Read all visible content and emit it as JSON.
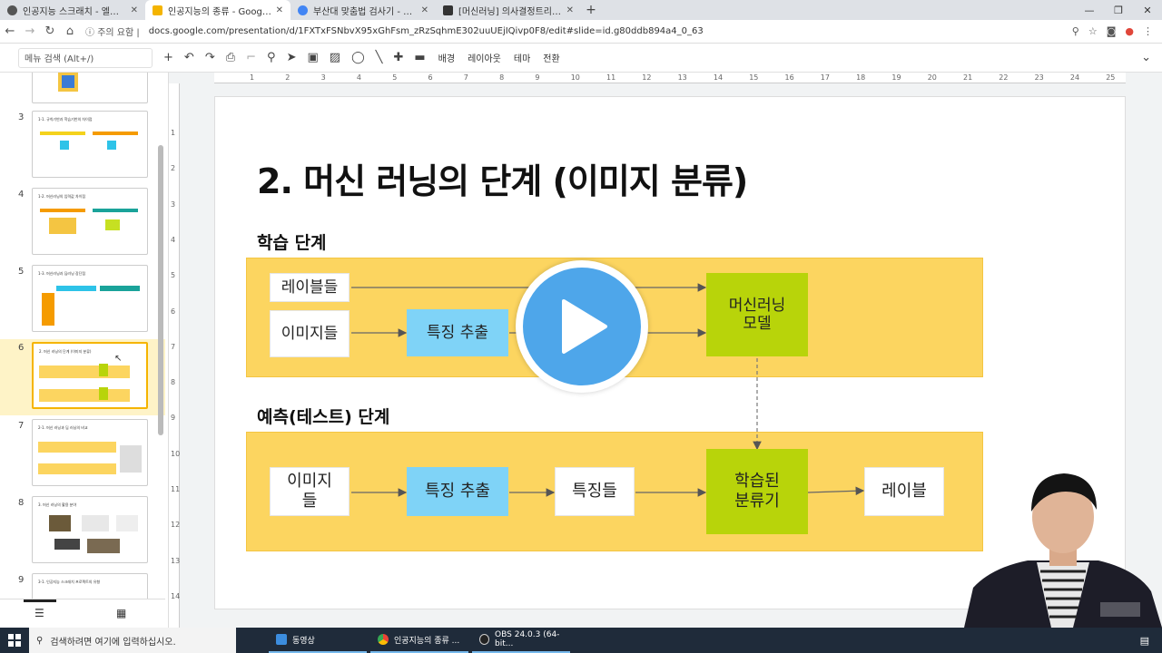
{
  "browser": {
    "tabs": [
      {
        "title": "인공지능 스크래치 - 엘로소프트",
        "favicon_color": "#555555"
      },
      {
        "title": "인공지능의 종류 - Google 프리젠",
        "favicon_color": "#f4b400"
      },
      {
        "title": "부산대 맞춤법 검사기 - Google",
        "favicon_color": "#4285f4"
      },
      {
        "title": "[머신러닝] 의사결정트리 (Decisi",
        "favicon_color": "#333333"
      }
    ],
    "new_tab": "+",
    "address": {
      "security": "주의 요함",
      "url": "docs.google.com/presentation/d/1FXTxFSNbvX95xGhFsm_zRzSqhmE302uuUEjIQivp0F8/edit#slide=id.g80ddb894a4_0_63"
    }
  },
  "toolbar": {
    "menu_search_placeholder": "메뉴 검색 (Alt+/)",
    "background": "배경",
    "layout": "레이아웃",
    "theme": "테마",
    "transition": "전환"
  },
  "ruler": {
    "h_ticks": [
      "1",
      "2",
      "3",
      "4",
      "5",
      "6",
      "7",
      "8",
      "9",
      "10",
      "11",
      "12",
      "13",
      "14",
      "15",
      "16",
      "17",
      "18",
      "19",
      "20",
      "21",
      "22",
      "23",
      "24",
      "25"
    ],
    "v_ticks": [
      "1",
      "2",
      "3",
      "4",
      "5",
      "6",
      "7",
      "8",
      "9",
      "10",
      "11",
      "12",
      "13",
      "14"
    ]
  },
  "sidebar": {
    "slides": [
      {
        "num": "3",
        "title": "1-1. 규칙기반과 학습기반의 차이점"
      },
      {
        "num": "4",
        "title": "1-2. 머신러닝의 입력값 차이점"
      },
      {
        "num": "5",
        "title": "1-3. 머신러닝과 딥러닝 장단점"
      },
      {
        "num": "6",
        "title": "2. 머신 러닝의 단계 (이미지 분류)"
      },
      {
        "num": "7",
        "title": "2-1. 머신 러닝과 딥 러닝의 비교"
      },
      {
        "num": "8",
        "title": "3. 머신 러닝의 활용 분야"
      },
      {
        "num": "9",
        "title": "3-1. 인공지능 스크래치 프로젝트의 유형"
      }
    ]
  },
  "slide": {
    "title": "2. 머신 러닝의 단계 (이미지 분류)",
    "train_label": "학습 단계",
    "predict_label": "예측(테스트) 단계",
    "train": {
      "labels": "레이블들",
      "images": "이미지들",
      "feature": "특징 추출",
      "model": "머신러닝\n모델"
    },
    "predict": {
      "image": "이미지\n들",
      "feature": "특징 추출",
      "features": "특징들",
      "classifier": "학습된\n분류기",
      "label": "레이블"
    }
  },
  "taskbar": {
    "search_placeholder": "검색하려면 여기에 입력하십시오.",
    "apps": [
      {
        "label": "동영상",
        "color": "#3c8dde"
      },
      {
        "label": "인공지능의 종류 ...",
        "color": "#f4b400"
      },
      {
        "label": "OBS 24.0.3 (64-bit...",
        "color": "#222222"
      }
    ]
  },
  "colors": {
    "band": "#fcd560",
    "blue_box": "#7fd3f7",
    "green_box": "#b8d40a",
    "play": "#4ea6ea"
  }
}
